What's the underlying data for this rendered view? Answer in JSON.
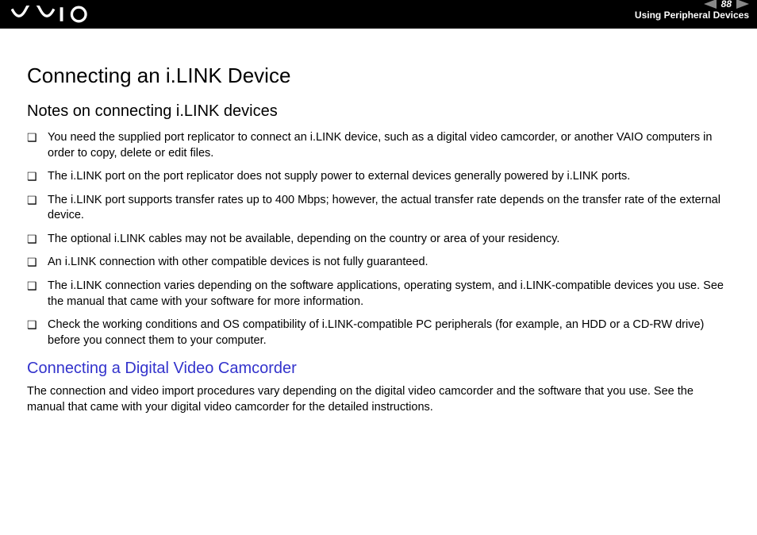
{
  "header": {
    "page_number": "88",
    "section": "Using Peripheral Devices",
    "logo_alt": "VAIO"
  },
  "content": {
    "title": "Connecting an i.LINK Device",
    "subtitle_notes": "Notes on connecting i.LINK devices",
    "notes": [
      "You need the supplied port replicator to connect an i.LINK device, such as a digital video camcorder, or another VAIO computers in order to copy, delete or edit files.",
      "The i.LINK port on the port replicator does not supply power to external devices generally powered by i.LINK ports.",
      "The i.LINK port supports transfer rates up to 400 Mbps; however, the actual transfer rate depends on the transfer rate of the external device.",
      "The optional i.LINK cables may not be available, depending on the country or area of your residency.",
      "An i.LINK connection with other compatible devices is not fully guaranteed.",
      "The i.LINK connection varies depending on the software applications, operating system, and i.LINK-compatible devices you use. See the manual that came with your software for more information.",
      "Check the working conditions and OS compatibility of i.LINK-compatible PC peripherals (for example, an HDD or a CD-RW drive) before you connect them to your computer."
    ],
    "subtitle_camcorder": "Connecting a Digital Video Camcorder",
    "camcorder_body": "The connection and video import procedures vary depending on the digital video camcorder and the software that you use. See the manual that came with your digital video camcorder for the detailed instructions."
  }
}
